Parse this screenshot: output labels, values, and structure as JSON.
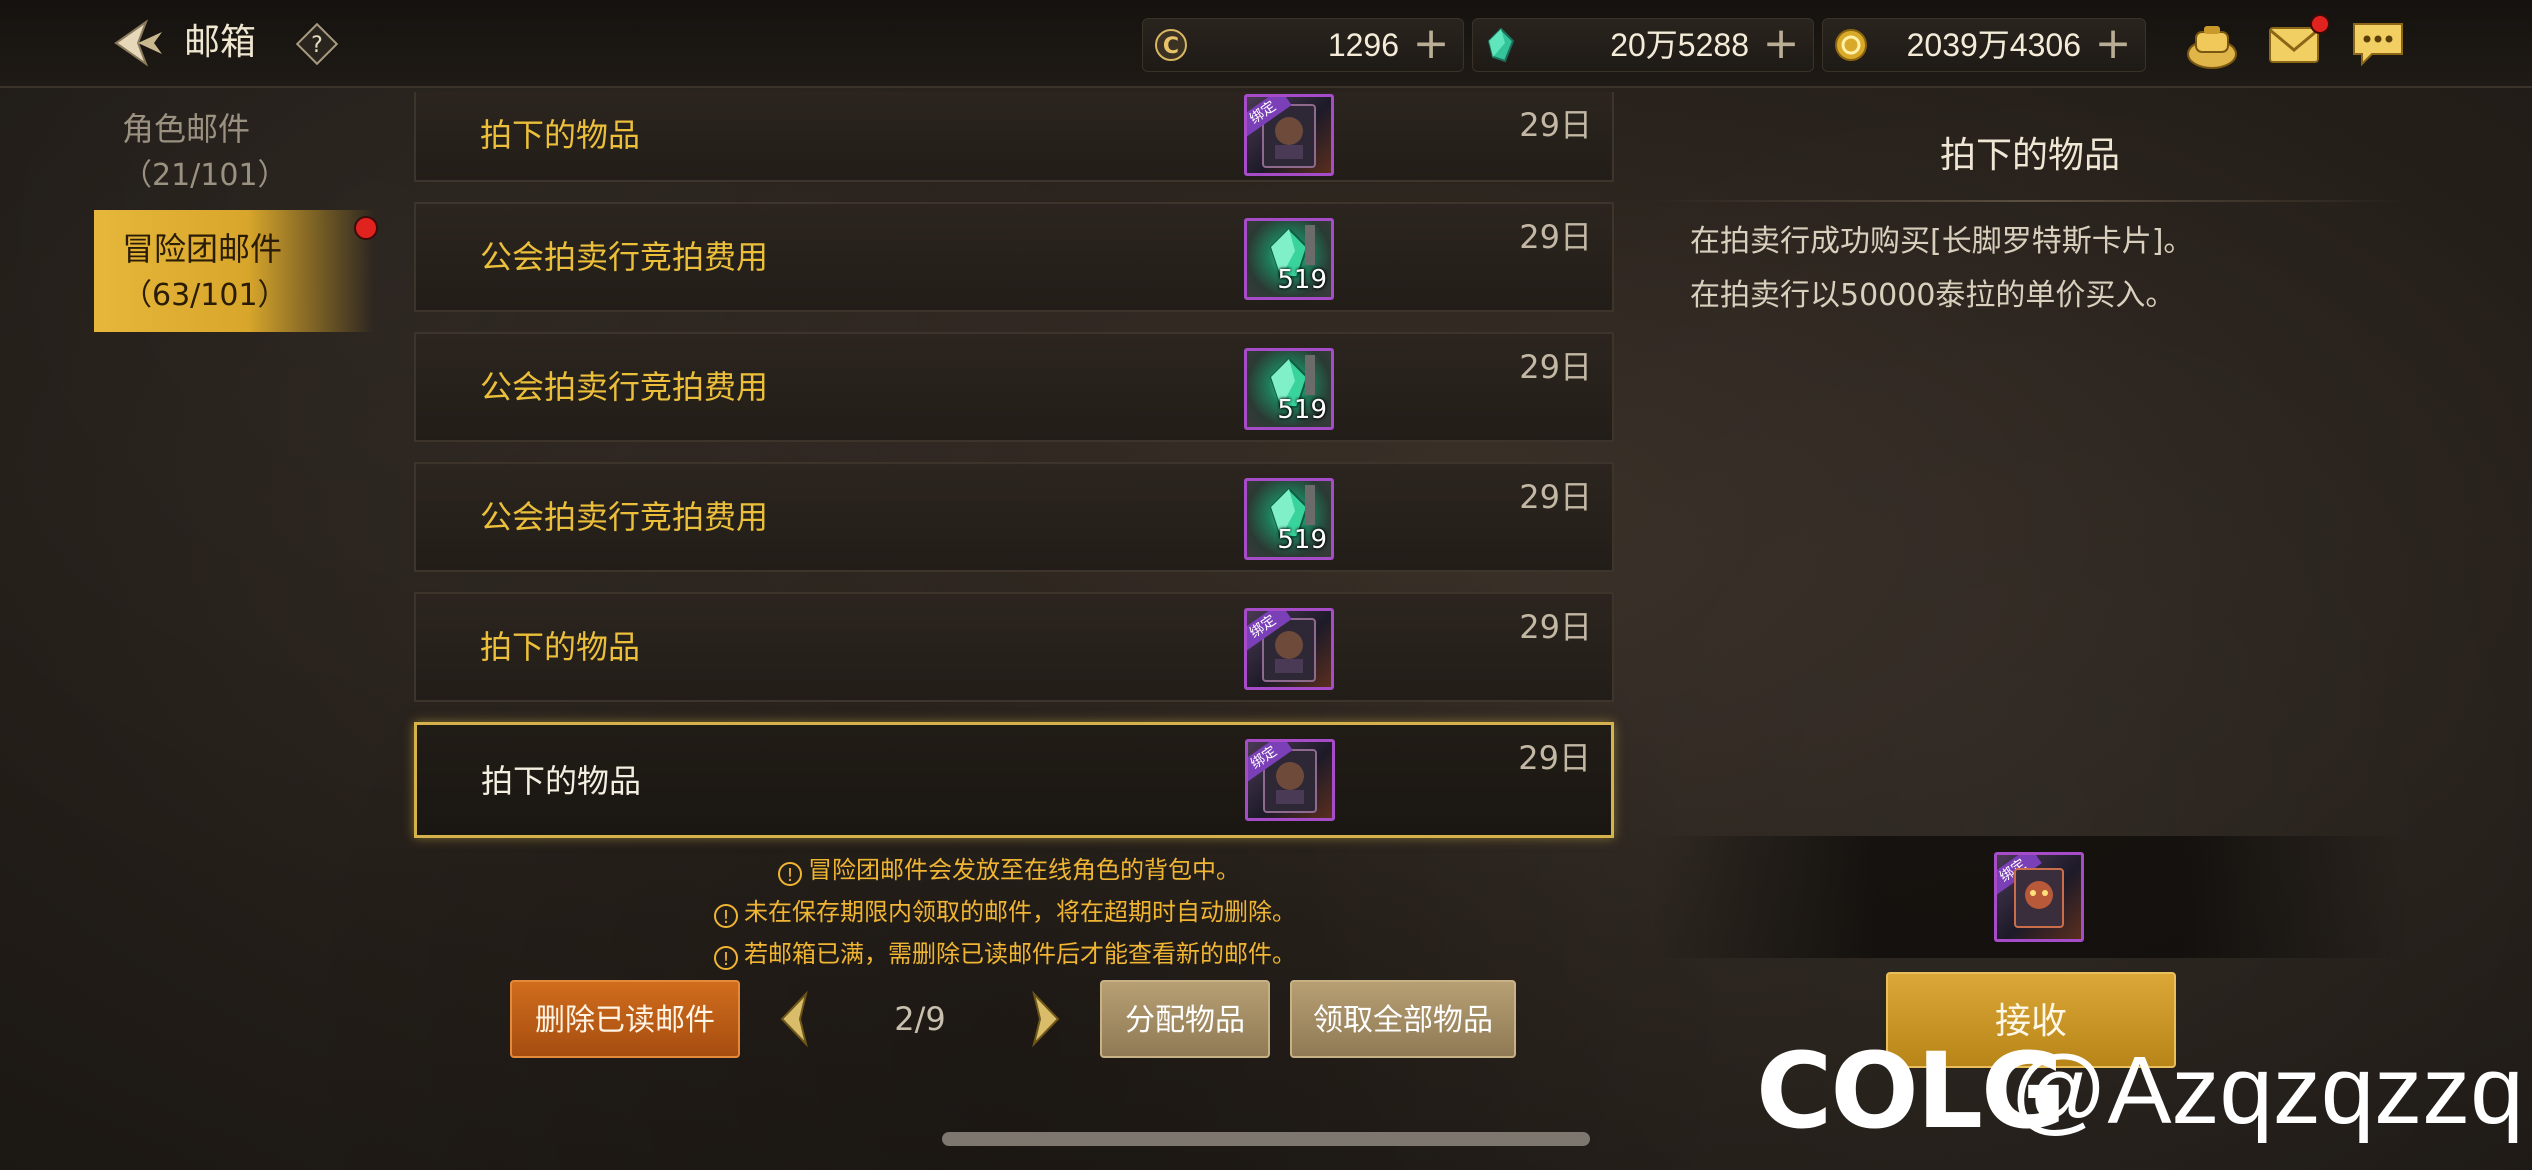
{
  "header": {
    "title": "邮箱",
    "help_label": "?"
  },
  "currencies": [
    {
      "icon": "coin-c-icon",
      "value": "1296"
    },
    {
      "icon": "green-crystal-icon",
      "value": "20万5288"
    },
    {
      "icon": "gold-coin-icon",
      "value": "2039万4306"
    }
  ],
  "sidebar": {
    "tabs": [
      {
        "label": "角色邮件",
        "count": "（21/101）",
        "selected": false
      },
      {
        "label": "冒险团邮件",
        "count": "（63/101）",
        "selected": true
      }
    ]
  },
  "mails": [
    {
      "subject": "拍下的物品",
      "days": "29日",
      "item": "card",
      "bound": true,
      "qty": ""
    },
    {
      "subject": "公会拍卖行竞拍费用",
      "days": "29日",
      "item": "gem",
      "bound": false,
      "qty": "519"
    },
    {
      "subject": "公会拍卖行竞拍费用",
      "days": "29日",
      "item": "gem",
      "bound": false,
      "qty": "519"
    },
    {
      "subject": "公会拍卖行竞拍费用",
      "days": "29日",
      "item": "gem",
      "bound": false,
      "qty": "519"
    },
    {
      "subject": "拍下的物品",
      "days": "29日",
      "item": "card",
      "bound": true,
      "qty": ""
    },
    {
      "subject": "拍下的物品",
      "days": "29日",
      "item": "card",
      "bound": true,
      "qty": "",
      "selected": true
    }
  ],
  "item_tag": "绑定",
  "notices": [
    "冒险团邮件会发放至在线角色的背包中。",
    "未在保存期限内领取的邮件，将在超期时自动删除。",
    "若邮箱已满，需删除已读邮件后才能查看新的邮件。"
  ],
  "notice_mark": "!",
  "controls": {
    "delete_read": "删除已读邮件",
    "page": "2/9",
    "distribute": "分配物品",
    "claim_all": "领取全部物品"
  },
  "detail": {
    "title": "拍下的物品",
    "lines": [
      "在拍卖行成功购买[长脚罗特斯卡片]。",
      "在拍卖行以50000泰拉的单价买入。"
    ],
    "receive": "接收"
  },
  "watermark": {
    "logo": "COLG",
    "user": "@Azqzqzzq"
  },
  "colors": {
    "accent_gold": "#ecbf3a",
    "notice_orange": "#f0b533",
    "selected_border": "#d6b24c",
    "item_frame_purple": "#a74cc9"
  }
}
